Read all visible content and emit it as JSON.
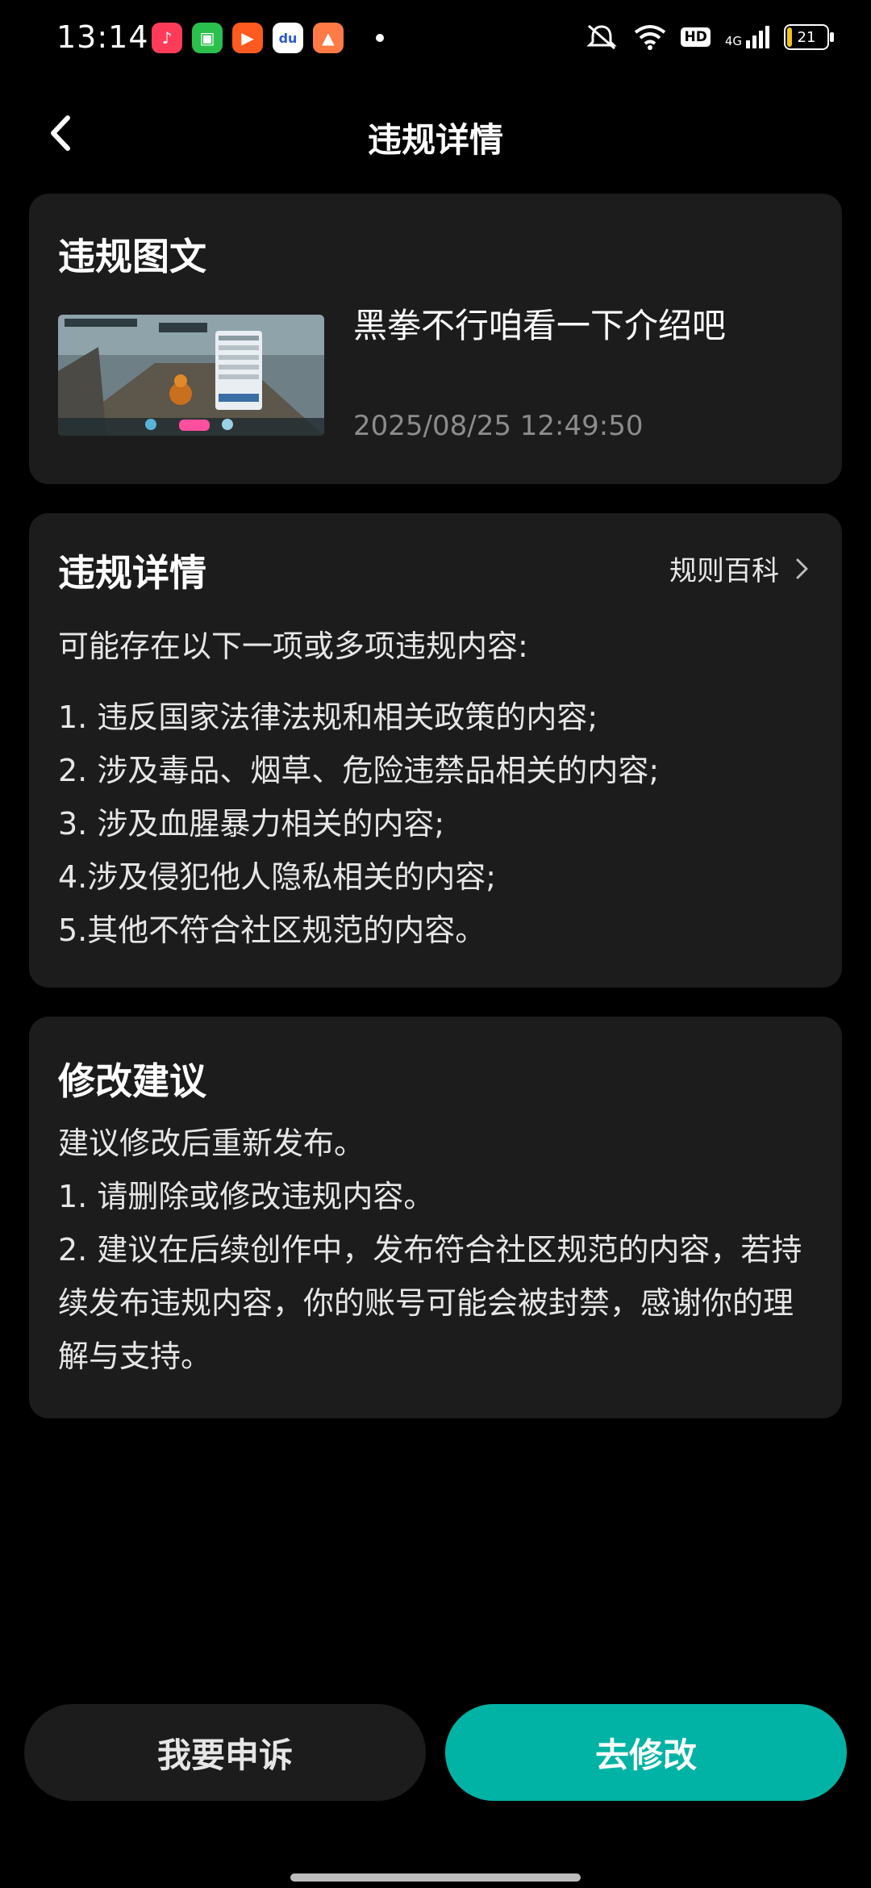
{
  "status_bar": {
    "time": "13:14",
    "app_icons": [
      {
        "name": "music-app-icon",
        "color": "#fe3c5a",
        "glyph": "♪"
      },
      {
        "name": "shop-app-icon",
        "color": "#2bbf4c",
        "glyph": "▣"
      },
      {
        "name": "video-app-icon",
        "color": "#ff5a1f",
        "glyph": "▶"
      },
      {
        "name": "baidu-app-icon",
        "color": "#ffffff",
        "glyph": "du"
      },
      {
        "name": "photo-app-icon",
        "color": "#ff7a45",
        "glyph": "▲"
      }
    ],
    "network": "4G",
    "hd": "HD",
    "battery": "21"
  },
  "header": {
    "title": "违规详情"
  },
  "card_post": {
    "title": "违规图文",
    "post_title": "黑拳不行咱看一下介绍吧",
    "post_time": "2025/08/25 12:49:50"
  },
  "card_details": {
    "title": "违规详情",
    "rules_link": "规则百科",
    "intro": "可能存在以下一项或多项违规内容:",
    "items": [
      "1. 违反国家法律法规和相关政策的内容;",
      "2. 涉及毒品、烟草、危险违禁品相关的内容;",
      "3. 涉及血腥暴力相关的内容;",
      "4.涉及侵犯他人隐私相关的内容;",
      "5.其他不符合社区规范的内容。"
    ]
  },
  "card_suggestion": {
    "title": "修改建议",
    "lines": [
      "建议修改后重新发布。",
      "1. 请删除或修改违规内容。",
      "2. 建议在后续创作中，发布符合社区规范的内容，若持续发布违规内容，你的账号可能会被封禁，感谢你的理解与支持。"
    ]
  },
  "buttons": {
    "appeal": "我要申诉",
    "edit": "去修改"
  },
  "colors": {
    "accent": "#00b3a5",
    "card_bg": "#1c1c1c"
  }
}
